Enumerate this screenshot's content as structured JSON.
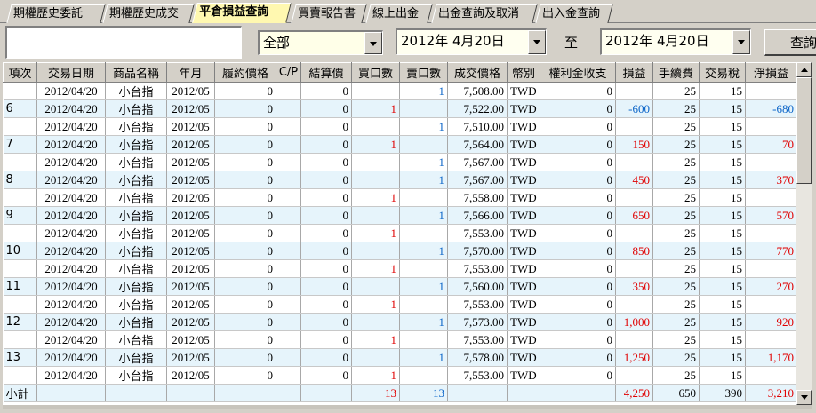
{
  "tabs": [
    {
      "label": "期權歷史委託",
      "active": false
    },
    {
      "label": "期權歷史成交",
      "active": false
    },
    {
      "label": "平倉損益查詢",
      "active": true
    },
    {
      "label": "買賣報告書",
      "active": false
    },
    {
      "label": "線上出金",
      "active": false
    },
    {
      "label": "出金查詢及取消",
      "active": false
    },
    {
      "label": "出入金查詢",
      "active": false
    }
  ],
  "filters": {
    "account_value": "",
    "category_value": "全部",
    "start_date": "2012年  4月20日",
    "to_label": "至",
    "end_date": "2012年  4月20日",
    "query_button": "查詢"
  },
  "table": {
    "columns": [
      "項次",
      "交易日期",
      "商品名稱",
      "年月",
      "履約價格",
      "C/P",
      "結算價",
      "買口數",
      "賣口數",
      "成交價格",
      "幣別",
      "權利金收支",
      "損益",
      "手續費",
      "交易稅",
      "淨損益"
    ],
    "rows": [
      {
        "item": "",
        "date": "2012/04/20",
        "product": "小台指",
        "ym": "2012/05",
        "strike": "0",
        "cp": "",
        "settle": "0",
        "buy": "",
        "sell": "1",
        "price": "7,508.00",
        "ccy": "TWD",
        "premium": "0",
        "pl": "",
        "fee": "25",
        "tax": "15",
        "net": ""
      },
      {
        "item": "6",
        "date": "2012/04/20",
        "product": "小台指",
        "ym": "2012/05",
        "strike": "0",
        "cp": "",
        "settle": "0",
        "buy": "1",
        "sell": "",
        "price": "7,522.00",
        "ccy": "TWD",
        "premium": "0",
        "pl": "-600",
        "fee": "25",
        "tax": "15",
        "net": "-680"
      },
      {
        "item": "",
        "date": "2012/04/20",
        "product": "小台指",
        "ym": "2012/05",
        "strike": "0",
        "cp": "",
        "settle": "0",
        "buy": "",
        "sell": "1",
        "price": "7,510.00",
        "ccy": "TWD",
        "premium": "0",
        "pl": "",
        "fee": "25",
        "tax": "15",
        "net": ""
      },
      {
        "item": "7",
        "date": "2012/04/20",
        "product": "小台指",
        "ym": "2012/05",
        "strike": "0",
        "cp": "",
        "settle": "0",
        "buy": "1",
        "sell": "",
        "price": "7,564.00",
        "ccy": "TWD",
        "premium": "0",
        "pl": "150",
        "fee": "25",
        "tax": "15",
        "net": "70"
      },
      {
        "item": "",
        "date": "2012/04/20",
        "product": "小台指",
        "ym": "2012/05",
        "strike": "0",
        "cp": "",
        "settle": "0",
        "buy": "",
        "sell": "1",
        "price": "7,567.00",
        "ccy": "TWD",
        "premium": "0",
        "pl": "",
        "fee": "25",
        "tax": "15",
        "net": ""
      },
      {
        "item": "8",
        "date": "2012/04/20",
        "product": "小台指",
        "ym": "2012/05",
        "strike": "0",
        "cp": "",
        "settle": "0",
        "buy": "",
        "sell": "1",
        "price": "7,567.00",
        "ccy": "TWD",
        "premium": "0",
        "pl": "450",
        "fee": "25",
        "tax": "15",
        "net": "370"
      },
      {
        "item": "",
        "date": "2012/04/20",
        "product": "小台指",
        "ym": "2012/05",
        "strike": "0",
        "cp": "",
        "settle": "0",
        "buy": "1",
        "sell": "",
        "price": "7,558.00",
        "ccy": "TWD",
        "premium": "0",
        "pl": "",
        "fee": "25",
        "tax": "15",
        "net": ""
      },
      {
        "item": "9",
        "date": "2012/04/20",
        "product": "小台指",
        "ym": "2012/05",
        "strike": "0",
        "cp": "",
        "settle": "0",
        "buy": "",
        "sell": "1",
        "price": "7,566.00",
        "ccy": "TWD",
        "premium": "0",
        "pl": "650",
        "fee": "25",
        "tax": "15",
        "net": "570"
      },
      {
        "item": "",
        "date": "2012/04/20",
        "product": "小台指",
        "ym": "2012/05",
        "strike": "0",
        "cp": "",
        "settle": "0",
        "buy": "1",
        "sell": "",
        "price": "7,553.00",
        "ccy": "TWD",
        "premium": "0",
        "pl": "",
        "fee": "25",
        "tax": "15",
        "net": ""
      },
      {
        "item": "10",
        "date": "2012/04/20",
        "product": "小台指",
        "ym": "2012/05",
        "strike": "0",
        "cp": "",
        "settle": "0",
        "buy": "",
        "sell": "1",
        "price": "7,570.00",
        "ccy": "TWD",
        "premium": "0",
        "pl": "850",
        "fee": "25",
        "tax": "15",
        "net": "770"
      },
      {
        "item": "",
        "date": "2012/04/20",
        "product": "小台指",
        "ym": "2012/05",
        "strike": "0",
        "cp": "",
        "settle": "0",
        "buy": "1",
        "sell": "",
        "price": "7,553.00",
        "ccy": "TWD",
        "premium": "0",
        "pl": "",
        "fee": "25",
        "tax": "15",
        "net": ""
      },
      {
        "item": "11",
        "date": "2012/04/20",
        "product": "小台指",
        "ym": "2012/05",
        "strike": "0",
        "cp": "",
        "settle": "0",
        "buy": "",
        "sell": "1",
        "price": "7,560.00",
        "ccy": "TWD",
        "premium": "0",
        "pl": "350",
        "fee": "25",
        "tax": "15",
        "net": "270"
      },
      {
        "item": "",
        "date": "2012/04/20",
        "product": "小台指",
        "ym": "2012/05",
        "strike": "0",
        "cp": "",
        "settle": "0",
        "buy": "1",
        "sell": "",
        "price": "7,553.00",
        "ccy": "TWD",
        "premium": "0",
        "pl": "",
        "fee": "25",
        "tax": "15",
        "net": ""
      },
      {
        "item": "12",
        "date": "2012/04/20",
        "product": "小台指",
        "ym": "2012/05",
        "strike": "0",
        "cp": "",
        "settle": "0",
        "buy": "",
        "sell": "1",
        "price": "7,573.00",
        "ccy": "TWD",
        "premium": "0",
        "pl": "1,000",
        "fee": "25",
        "tax": "15",
        "net": "920"
      },
      {
        "item": "",
        "date": "2012/04/20",
        "product": "小台指",
        "ym": "2012/05",
        "strike": "0",
        "cp": "",
        "settle": "0",
        "buy": "1",
        "sell": "",
        "price": "7,553.00",
        "ccy": "TWD",
        "premium": "0",
        "pl": "",
        "fee": "25",
        "tax": "15",
        "net": ""
      },
      {
        "item": "13",
        "date": "2012/04/20",
        "product": "小台指",
        "ym": "2012/05",
        "strike": "0",
        "cp": "",
        "settle": "0",
        "buy": "",
        "sell": "1",
        "price": "7,578.00",
        "ccy": "TWD",
        "premium": "0",
        "pl": "1,250",
        "fee": "25",
        "tax": "15",
        "net": "1,170"
      },
      {
        "item": "",
        "date": "2012/04/20",
        "product": "小台指",
        "ym": "2012/05",
        "strike": "0",
        "cp": "",
        "settle": "0",
        "buy": "1",
        "sell": "",
        "price": "7,553.00",
        "ccy": "TWD",
        "premium": "0",
        "pl": "",
        "fee": "25",
        "tax": "15",
        "net": ""
      }
    ],
    "subtotal": {
      "label": "小計",
      "buy": "13",
      "sell": "13",
      "pl": "4,250",
      "fee": "650",
      "tax": "390",
      "net": "3,210"
    }
  },
  "colors": {
    "buy": "#e00000",
    "sell": "#0a64c8",
    "profit": "#e00000",
    "loss": "#0a64c8",
    "active_tab": "#fff8b0",
    "alt_row": "#e6f4fb"
  }
}
